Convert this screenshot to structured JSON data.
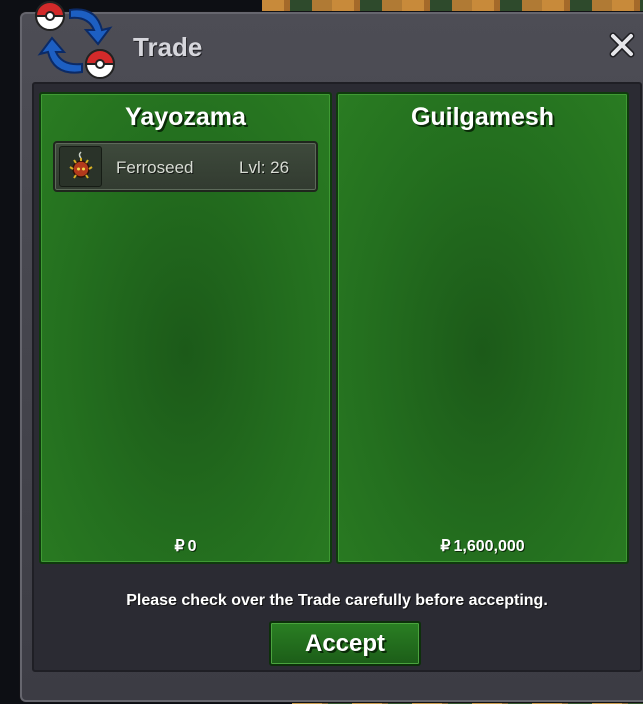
{
  "window": {
    "title": "Trade"
  },
  "trade": {
    "left": {
      "player_name": "Yayozama",
      "currency_symbol": "₽",
      "money": "0",
      "pokemon": [
        {
          "name": "Ferroseed",
          "level": "Lvl: 26",
          "icon": "ferroseed-sprite-icon"
        }
      ]
    },
    "right": {
      "player_name": "Guilgamesh",
      "currency_symbol": "₽",
      "money": "1,600,000",
      "pokemon": []
    }
  },
  "notice": "Please check over the Trade carefully before accepting.",
  "accept_label": "Accept",
  "colors": {
    "panel_green": "#24701f",
    "window_gray": "#45454d",
    "accent_blue": "#1d5fc2",
    "accent_red": "#d22a2a"
  }
}
